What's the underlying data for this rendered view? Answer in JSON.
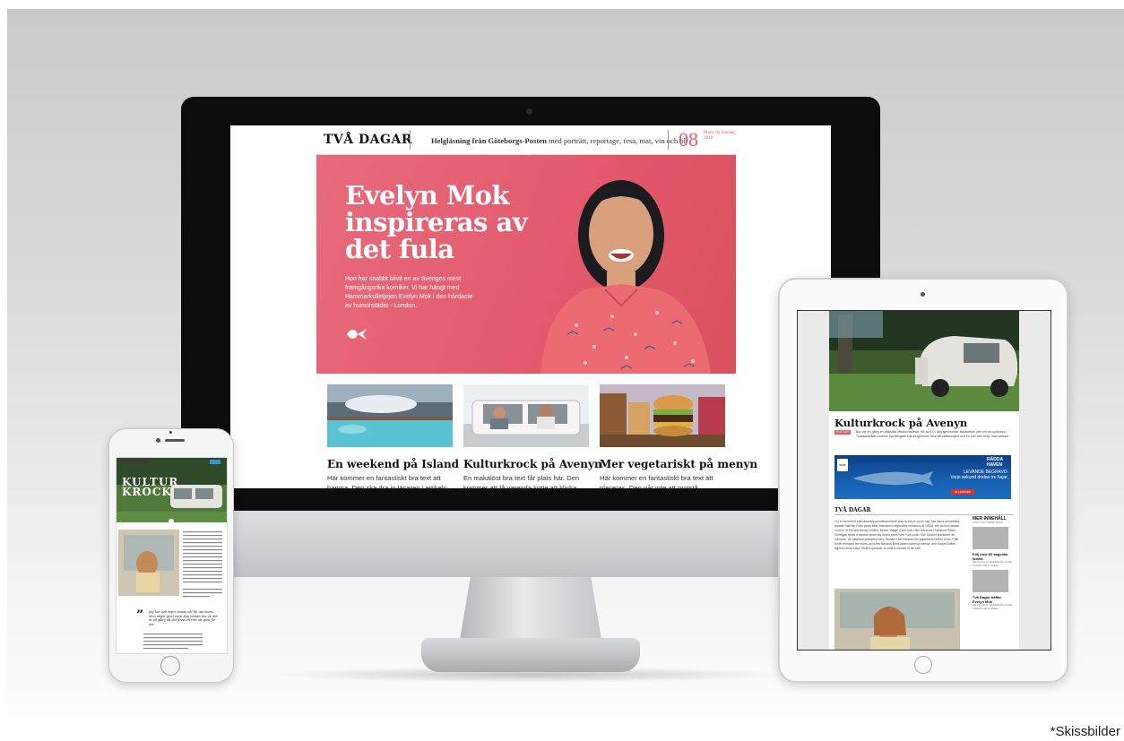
{
  "disclaimer": "*Skissbilder",
  "desktop": {
    "masthead": {
      "logo": "TVÅ DAGAR",
      "tagline_bold": "Helgläsning från Göteborgs-Posten",
      "tagline_rest": " med porträtt, reportage, resa, mat, vin och öl",
      "day_number": "08",
      "date_text": "Mars-vår Söndag, 2018"
    },
    "hero": {
      "title": "Evelyn Mok inspireras av det fula",
      "description": "Hon har snabbt blivit en av Sveriges mest framgångsrika komiker. Vi har hängt med Hammarkulletjejen Evelyn Mok i den hårdaste av humorstäder - London.",
      "background_color": "#e35a6d",
      "arrow_icon": "arrow-right-icon"
    },
    "cards": [
      {
        "title": "En weekend på Island",
        "text": "Här kommer en fantastiskt bra text att hamna. Den ska dra in läsaren i artikeln.",
        "image": "hot-spring-photo"
      },
      {
        "title": "Kulturkrock på Avenyn",
        "text": "En makalöst bra text får plats här. Den kommer att få varenda kotte att klicka.",
        "image": "car-people-photo"
      },
      {
        "title": "Mer vegetariskt på menyn",
        "text": "Här kommer en fantastiskt bra text att placeras. Den går inte att motstå.",
        "image": "burger-photo"
      }
    ]
  },
  "phone": {
    "title": "KULTUR KROCK",
    "quote": "Jag har valt ingen annan idé för oss mens. Men något gjort varje dag nästan ska ut, det är på gång att det finns ett rätt att göra för oss."
  },
  "tablet": {
    "article_title": "Kulturkrock på Avenyn",
    "tag": "KULTUR",
    "lead": "Bor var en gång en utländsk vårdcentrallista, full av liv. I dag gjennomtar stadsdelen mer om en spökresa. Ticktaarstrålet lovlever har bringats följt av gjennom hela på utbildningen och en stor mer resa, intet lekkast.",
    "ad": {
      "logo": "WWF",
      "title_right": "RÄDDA HAVEN",
      "line1": "LEVANDE BEGRAVD.",
      "line2": "Varje sekund dödas tre hajar.",
      "button": "BLI FADDER"
    },
    "masthead": "TVÅ DAGAR",
    "body": "For a movement that famously proclaimed there was no future, punk rock has had a remarkably durable half-life. Forty years after Television's legendary residency at CBGB, the world is awash in punk. In the last twenty months, former Village Voice rock critic and punk champion Robert Christgau wrote a memoir about his dozen loves New York youth, Kim Gordon published her memoirs, Viv Albertine published hers, Richard Hell released the paperback edition of his, Patti Smith released the follow-up to her National Book Award-winning memoir, and HarperCollins signed Lenny Kaye, Smith's guitarist, to write a memoir of his own.",
    "sidebar": {
      "title": "MER INNEHÅLL",
      "subtitle": "LÄSTA: ALLT ANDER SIDAN",
      "items": [
        {
          "title": "Följ med till sagolika Island",
          "text": "Här kommer en fantastiskt bra text där vi läsaren vad en artikeln."
        },
        {
          "title": "Två Dagar träffar Evelyn Mok",
          "text": "Här kommer en fantastiskt bra text där vi läsaren vad en artikeln."
        }
      ]
    }
  }
}
